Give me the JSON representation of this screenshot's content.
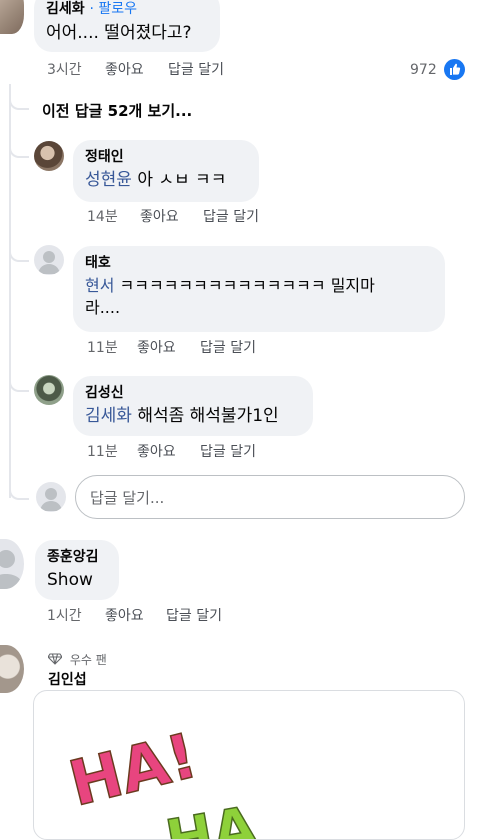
{
  "comments": {
    "top": {
      "author": "김세화",
      "follow_label": "· 팔로우",
      "text": "어어.... 떨어졌다고?",
      "time": "3시간",
      "like_label": "좋아요",
      "reply_label": "답글 달기",
      "reaction_count": "972"
    },
    "view_previous": "이전 답글 52개 보기...",
    "replies": [
      {
        "author": "정태인",
        "mention": "성현윤",
        "text": " 아 ㅅㅂ ㅋㅋ",
        "time": "14분",
        "like_label": "좋아요",
        "reply_label": "답글 달기"
      },
      {
        "author": "태호",
        "mention": "현서",
        "text": " ㅋㅋㅋㅋㅋㅋㅋㅋㅋㅋㅋㅋㅋㅋ 밀지마",
        "text2": "라....",
        "time": "11분",
        "like_label": "좋아요",
        "reply_label": "답글 달기"
      },
      {
        "author": "김성신",
        "mention": "김세화",
        "text": " 해석좀 해석불가1인",
        "time": "11분",
        "like_label": "좋아요",
        "reply_label": "답글 달기"
      }
    ],
    "reply_input": {
      "placeholder": "답글 달기..."
    },
    "second": {
      "author": "종훈앙김",
      "text": "Show",
      "time": "1시간",
      "like_label": "좋아요",
      "reply_label": "답글 달기"
    },
    "third": {
      "badge": "우수 팬",
      "author": "김인섭",
      "sticker_text": "HA!",
      "sticker_text2": "HA"
    }
  },
  "colors": {
    "bubble": "#f0f2f5",
    "mention": "#385898",
    "like_blue": "#1877f2",
    "sticker_pink": "#e8457f",
    "sticker_green": "#8ed13a"
  }
}
